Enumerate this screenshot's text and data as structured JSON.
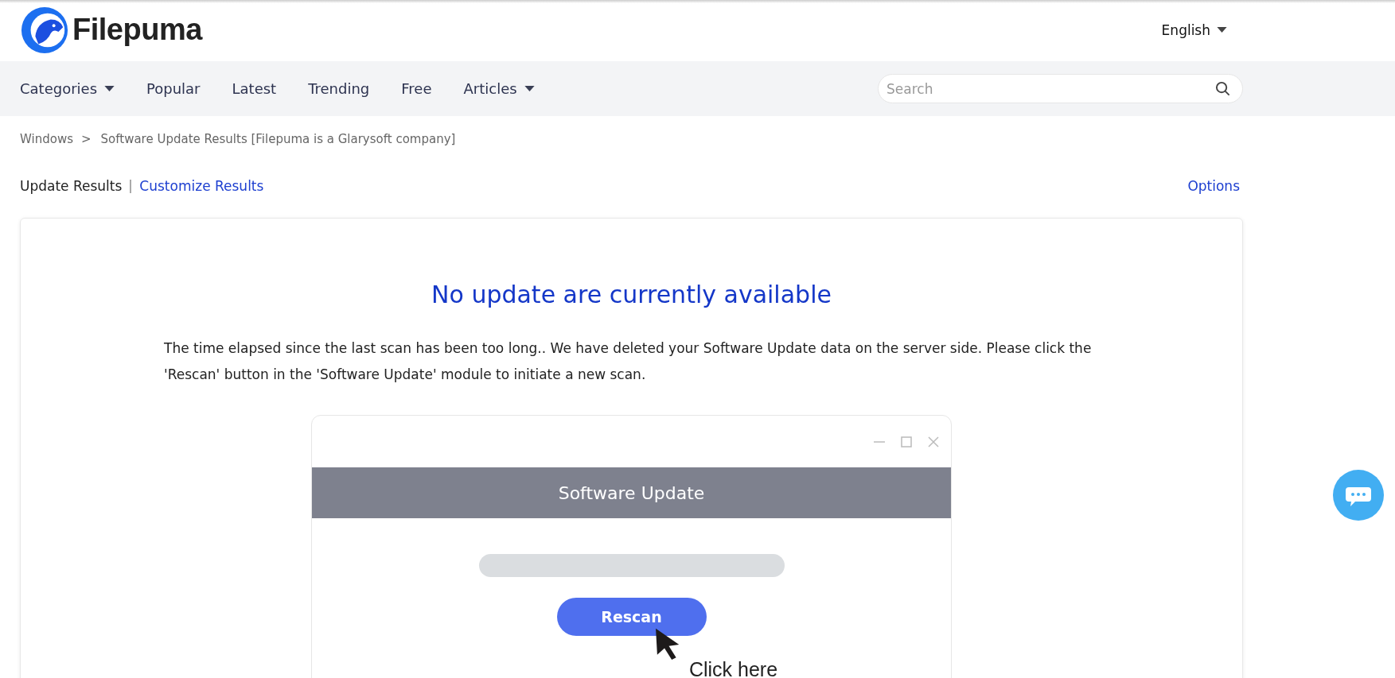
{
  "header": {
    "logo_text": "Filepuma",
    "language": "English"
  },
  "nav": {
    "items": [
      {
        "label": "Categories",
        "dropdown": true
      },
      {
        "label": "Popular",
        "dropdown": false
      },
      {
        "label": "Latest",
        "dropdown": false
      },
      {
        "label": "Trending",
        "dropdown": false
      },
      {
        "label": "Free",
        "dropdown": false
      },
      {
        "label": "Articles",
        "dropdown": true
      }
    ],
    "search": {
      "placeholder": "Search"
    }
  },
  "breadcrumb_separator": ">",
  "breadcrumb": [
    {
      "label": "Windows"
    },
    {
      "label": "Software Update Results [Filepuma is a Glarysoft company]"
    }
  ],
  "tabs": [
    {
      "label": "Update Results",
      "selected": true
    },
    {
      "label": "Customize Results",
      "selected": false
    }
  ],
  "options_link": "Options",
  "card": {
    "heading": "No update are currently available",
    "message": "The time elapsed since the last scan has been too long.. We have deleted your Software Update data on the server side. Please click the 'Rescan' button in the 'Software Update' module to initiate a new scan.",
    "illustration": {
      "window_title": "Software Update",
      "button": "Rescan",
      "hint": "Click here"
    }
  }
}
